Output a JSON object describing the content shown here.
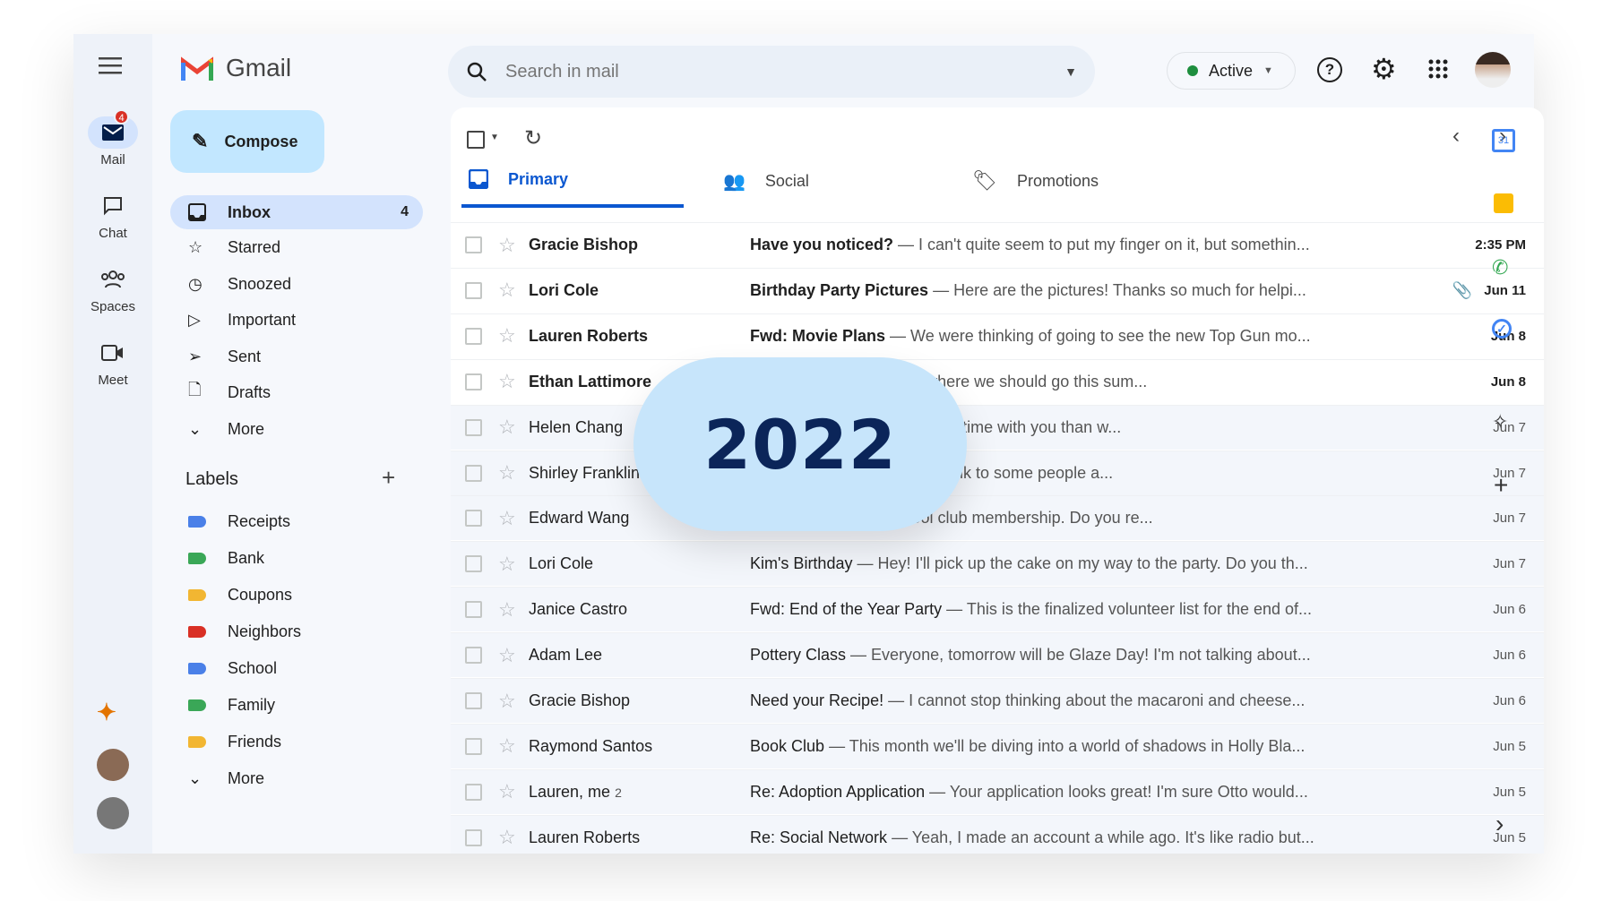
{
  "app": {
    "name": "Gmail"
  },
  "rail": [
    {
      "label": "Mail",
      "badge": "4"
    },
    {
      "label": "Chat"
    },
    {
      "label": "Spaces"
    },
    {
      "label": "Meet"
    }
  ],
  "compose": "Compose",
  "nav": [
    {
      "label": "Inbox",
      "count": "4"
    },
    {
      "label": "Starred"
    },
    {
      "label": "Snoozed"
    },
    {
      "label": "Important"
    },
    {
      "label": "Sent"
    },
    {
      "label": "Drafts"
    },
    {
      "label": "More"
    }
  ],
  "labels": {
    "title": "Labels",
    "items": [
      {
        "label": "Receipts",
        "color": "#4a80e8"
      },
      {
        "label": "Bank",
        "color": "#3aa757"
      },
      {
        "label": "Coupons",
        "color": "#f2b632"
      },
      {
        "label": "Neighbors",
        "color": "#d93025"
      },
      {
        "label": "School",
        "color": "#4a80e8"
      },
      {
        "label": "Family",
        "color": "#3aa757"
      },
      {
        "label": "Friends",
        "color": "#f2b632"
      }
    ],
    "more": "More"
  },
  "search": {
    "placeholder": "Search in mail"
  },
  "status": {
    "label": "Active",
    "color": "#1e8e3e"
  },
  "tabs": [
    {
      "label": "Primary",
      "active": true
    },
    {
      "label": "Social"
    },
    {
      "label": "Promotions"
    }
  ],
  "emails": [
    {
      "sender": "Gracie Bishop",
      "subject": "Have you noticed?",
      "snippet": " — I can't quite seem to put my finger on it, but somethin...",
      "date": "2:35 PM",
      "unread": true
    },
    {
      "sender": "Lori Cole",
      "subject": "Birthday Party Pictures",
      "snippet": " — Here are the pictures! Thanks so much for helpi...",
      "date": "Jun 11",
      "unread": true,
      "attachment": true
    },
    {
      "sender": "Lauren Roberts",
      "subject": "Fwd: Movie Plans",
      "snippet": " — We were thinking of going to see the new Top Gun mo...",
      "date": "Jun 8",
      "unread": true
    },
    {
      "sender": "Ethan Lattimore",
      "subject": "",
      "snippet": "Have you thought about where we should go this sum...",
      "date": "Jun 8",
      "unread": true
    },
    {
      "sender": "Helen Chang",
      "subject": "",
      "snippet": "point, my hat has spent more time with you than w...",
      "date": "Jun 7"
    },
    {
      "sender": "Shirley Franklin",
      "subject": "",
      "snippet": "n't realize that. I'm going to talk to some people a...",
      "date": "Jun 7"
    },
    {
      "sender": "Edward Wang",
      "subject": "",
      "snippet": "it's time to renew our pool club membership. Do you re...",
      "date": "Jun 7"
    },
    {
      "sender": "Lori Cole",
      "subject": "Kim's Birthday",
      "snippet": " — Hey! I'll pick up the cake on my way to the party. Do you th...",
      "date": "Jun 7"
    },
    {
      "sender": "Janice Castro",
      "subject": "Fwd: End of the Year Party",
      "snippet": " — This is the finalized volunteer list for the end of...",
      "date": "Jun 6"
    },
    {
      "sender": "Adam Lee",
      "subject": "Pottery Class",
      "snippet": " — Everyone, tomorrow will be Glaze Day! I'm not talking about...",
      "date": "Jun 6"
    },
    {
      "sender": "Gracie Bishop",
      "subject": "Need your Recipe!",
      "snippet": " — I cannot stop thinking about the macaroni and cheese...",
      "date": "Jun 6"
    },
    {
      "sender": "Raymond Santos",
      "subject": "Book Club",
      "snippet": " — This month we'll be diving into a world of shadows in Holly Bla...",
      "date": "Jun 5"
    },
    {
      "sender": "Lauren, me",
      "count": "2",
      "subject": "Re: Adoption Application",
      "snippet": " — Your application looks great! I'm sure Otto would...",
      "date": "Jun 5"
    },
    {
      "sender": "Lauren Roberts",
      "subject": "Re: Social Network",
      "snippet": " — Yeah, I made an account a while ago. It's like radio but...",
      "date": "Jun 5"
    }
  ],
  "overlay": {
    "year": "2022"
  },
  "accent": "#0b57d0"
}
